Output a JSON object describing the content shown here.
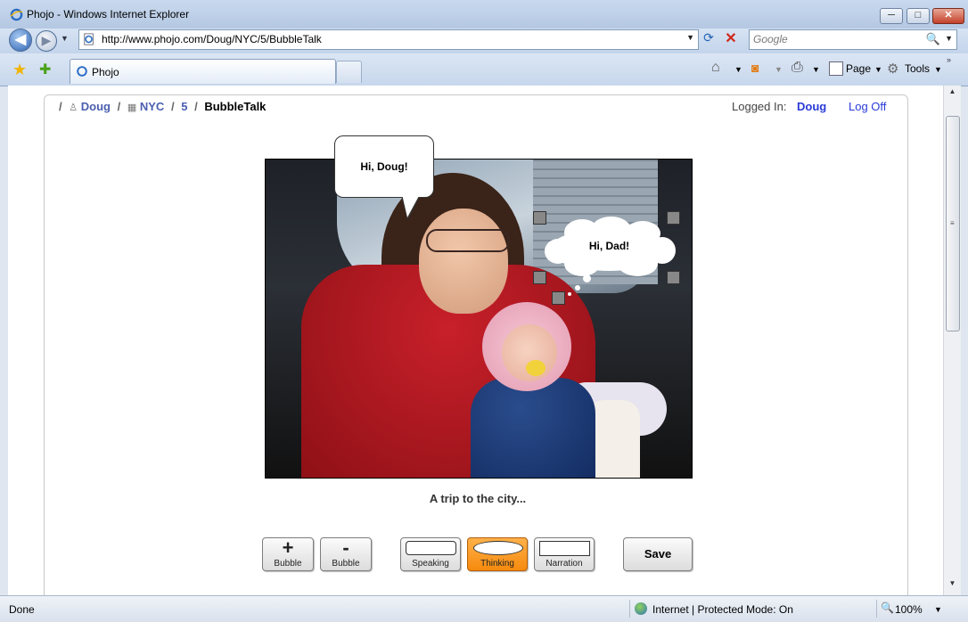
{
  "window": {
    "title": "Phojo - Windows Internet Explorer",
    "minimize": "─",
    "maximize": "□",
    "close": "✕"
  },
  "nav": {
    "back_icon": "◀",
    "forward_icon": "▶",
    "dropdown": "▼",
    "url": "http://www.phojo.com/Doug/NYC/5/BubbleTalk",
    "refresh_icon": "⟳",
    "stop_icon": "✕",
    "search_placeholder": "Google",
    "search_icon": "🔍"
  },
  "tabs": {
    "favorites_icon": "★",
    "add_favorites_icon": "✚",
    "active_tab": "Phojo",
    "more_icon": "»"
  },
  "commandbar": {
    "home_icon": "⌂",
    "feeds_icon": "◙",
    "print_icon": "⎙",
    "page_label": "Page",
    "tools_label": "Tools",
    "drop": "▼"
  },
  "page": {
    "breadcrumb": {
      "sep": "/",
      "user_icon": "♙",
      "user": "Doug",
      "album_icon": "▦",
      "album": "NYC",
      "photo": "5",
      "current": "BubbleTalk"
    },
    "login": {
      "label": "Logged In:",
      "user": "Doug",
      "logoff": "Log Off"
    },
    "bubbles": {
      "speaking_text": "Hi, Doug!",
      "thinking_text": "Hi, Dad!"
    },
    "caption": "A trip to the city...",
    "toolbar": {
      "add_symbol": "+",
      "add_label": "Bubble",
      "remove_symbol": "-",
      "remove_label": "Bubble",
      "speaking_label": "Speaking",
      "thinking_label": "Thinking",
      "narration_label": "Narration",
      "save_label": "Save"
    }
  },
  "scrollbar": {
    "up": "▲",
    "down": "▼",
    "grip": "≡"
  },
  "status": {
    "left": "Done",
    "zone": "Internet | Protected Mode: On",
    "zoom": "100%",
    "zoom_icon": "🔍",
    "drop": "▼"
  },
  "colors": {
    "link": "#4b5fb0",
    "login_user": "#2a3bd8",
    "thinking_active": "#f58a0d"
  }
}
